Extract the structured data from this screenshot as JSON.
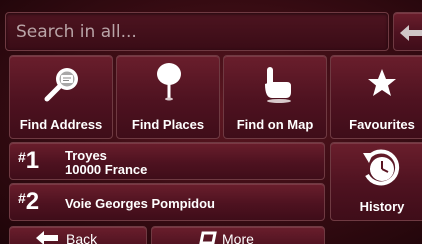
{
  "search": {
    "placeholder": "Search in all...",
    "icon": "backspace-arrow-icon"
  },
  "categories": [
    {
      "label": "Find Address",
      "icon": "find-address-icon"
    },
    {
      "label": "Find Places",
      "icon": "map-pin-icon"
    },
    {
      "label": "Find on Map",
      "icon": "pointing-hand-icon"
    },
    {
      "label": "Favourites",
      "icon": "star-icon"
    }
  ],
  "recent": [
    {
      "hash": "#",
      "number": "1",
      "line1": "Troyes",
      "line2": "10000 France"
    },
    {
      "hash": "#",
      "number": "2",
      "line1": "Voie Georges Pompidou",
      "line2": ""
    }
  ],
  "history": {
    "label": "History",
    "icon": "history-clock-icon"
  },
  "bottom_bar": {
    "back_label": "Back",
    "back_icon": "left-arrow-icon",
    "more_label": "More",
    "more_icon": "more-icon"
  }
}
